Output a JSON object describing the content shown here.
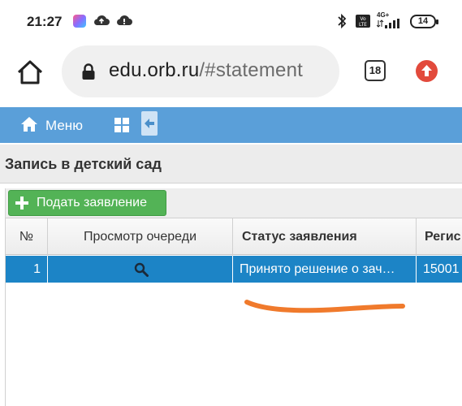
{
  "status_bar": {
    "time": "21:27",
    "battery": "14",
    "network": "4G+"
  },
  "browser": {
    "url_host": "edu.orb.ru",
    "url_path": "/#statement",
    "tab_count": "18"
  },
  "nav": {
    "menu_label": "Меню"
  },
  "section": {
    "title": "Запись в детский сад"
  },
  "toolbar": {
    "submit_label": "Подать заявление"
  },
  "table": {
    "columns": [
      "№",
      "Просмотр очереди",
      "Статус заявления",
      "Регис"
    ],
    "rows": [
      {
        "num": "1",
        "status": "Принято решение о зач…",
        "reg": "15001"
      }
    ]
  },
  "colors": {
    "nav_bg": "#5a9fd9",
    "selected_row": "#1c84c6",
    "submit_btn": "#53b356",
    "annotation_stroke": "#f07a2c"
  }
}
